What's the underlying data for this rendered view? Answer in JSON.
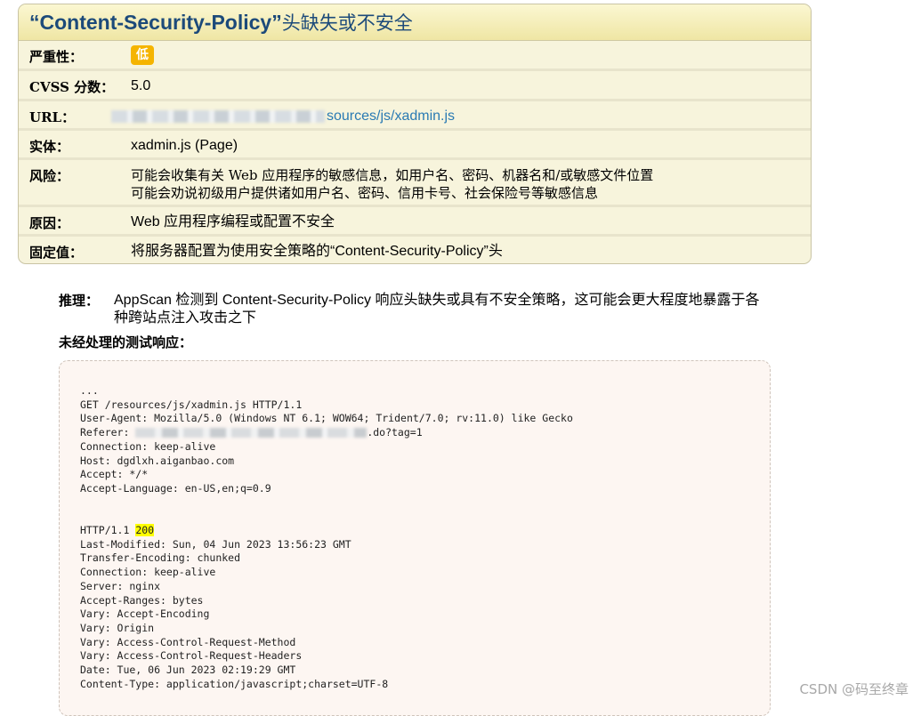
{
  "issue": {
    "title_quoted": "“Content-Security-Policy”",
    "title_rest": "头缺失或不安全",
    "severity": {
      "label": "严重性：",
      "value": "低"
    },
    "cvss": {
      "label": "CVSS 分数：",
      "value": "5.0"
    },
    "url": {
      "label": "URL：",
      "value_visible": "sources/js/xadmin.js"
    },
    "entity": {
      "label": "实体：",
      "value": "xadmin.js (Page)"
    },
    "risk": {
      "label": "风险：",
      "line1": "可能会收集有关 Web 应用程序的敏感信息，如用户名、密码、机器名和/或敏感文件位置",
      "line2": "可能会劝说初级用户提供诸如用户名、密码、信用卡号、社会保险号等敏感信息"
    },
    "cause": {
      "label": "原因：",
      "value": "Web 应用程序编程或配置不安全"
    },
    "fix": {
      "label": "固定值：",
      "value": "将服务器配置为使用安全策略的“Content-Security-Policy”头"
    }
  },
  "reasoning": {
    "label": "推理：",
    "text": "AppScan 检测到 Content-Security-Policy 响应头缺失或具有不安全策略，这可能会更大程度地暴露于各种跨站点注入攻击之下"
  },
  "raw_response": {
    "title": "未经处理的测试响应：",
    "request_lines": [
      "...",
      "GET /resources/js/xadmin.js HTTP/1.1",
      "User-Agent: Mozilla/5.0 (Windows NT 6.1; WOW64; Trident/7.0; rv:11.0) like Gecko"
    ],
    "referer_prefix": "Referer: ",
    "referer_suffix": ".do?tag=1",
    "request_lines_2": [
      "Connection: keep-alive",
      "Host: dgdlxh.aiganbao.com",
      "Accept: */*",
      "Accept-Language: en-US,en;q=0.9"
    ],
    "status_prefix": "HTTP/1.1 ",
    "status_code": "200",
    "response_lines": [
      "Last-Modified: Sun, 04 Jun 2023 13:56:23 GMT",
      "Transfer-Encoding: chunked",
      "Connection: keep-alive",
      "Server: nginx",
      "Accept-Ranges: bytes",
      "Vary: Accept-Encoding",
      "Vary: Origin",
      "Vary: Access-Control-Request-Method",
      "Vary: Access-Control-Request-Headers",
      "Date: Tue, 06 Jun 2023 02:19:29 GMT",
      "Content-Type: application/javascript;charset=UTF-8"
    ]
  },
  "watermark": "CSDN @码至终章",
  "colors": {
    "title": "#1c4a7a",
    "badge": "#f5b400",
    "link": "#2a7ab3",
    "highlight": "#ffff00"
  }
}
